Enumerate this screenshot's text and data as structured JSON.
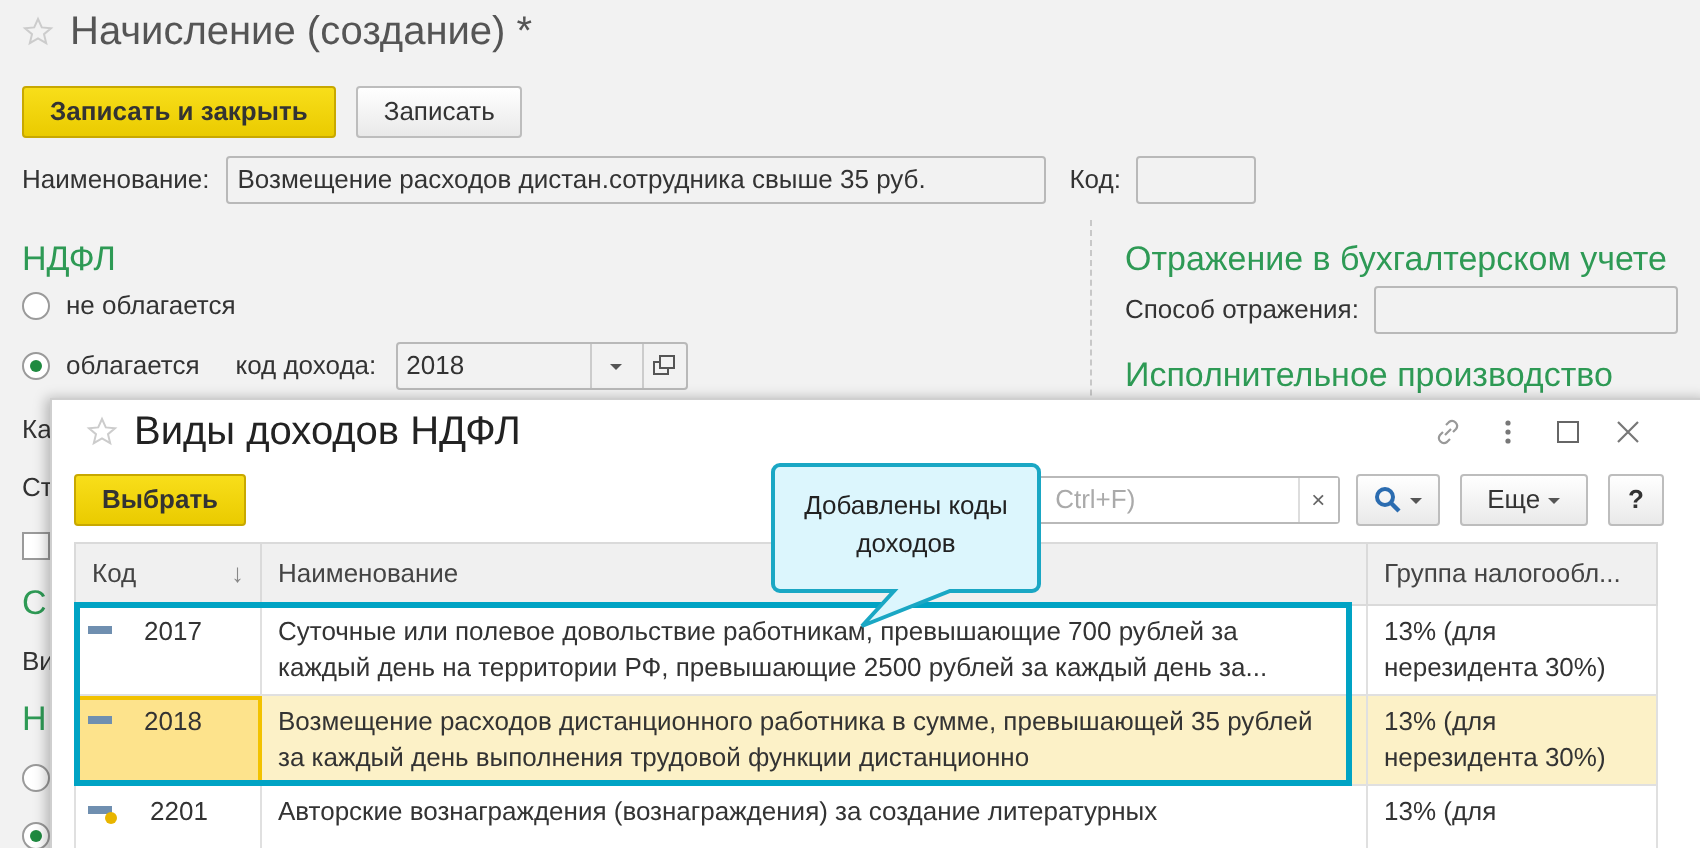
{
  "form": {
    "title": "Начисление (создание) *",
    "favorite": false,
    "buttons": [
      {
        "label": "Записать и закрыть",
        "kind": "primary"
      },
      {
        "label": "Записать",
        "kind": "default"
      }
    ],
    "name_label": "Наименование:",
    "name_value": "Возмещение расходов дистан.сотрудника свыше 35 руб.",
    "code_label": "Код:",
    "ndfl": {
      "heading": "НДФЛ",
      "options": [
        {
          "label": "не облагается",
          "selected": false
        },
        {
          "label": "облагается",
          "selected": true
        }
      ],
      "income_code_label": "код дохода:",
      "income_code_value": "2018"
    },
    "accounting": {
      "heading": "Отражение в бухгалтерском учете",
      "method_label": "Способ отражения:"
    },
    "enforcement_heading": "Исполнительное производство",
    "partial_items": [
      {
        "kind": "label",
        "text": "Ка"
      },
      {
        "kind": "label",
        "text": "Ст"
      },
      {
        "kind": "checkbox",
        "checked": false
      },
      {
        "kind": "heading",
        "text": "С"
      },
      {
        "kind": "label",
        "text": "Ви"
      },
      {
        "kind": "heading",
        "text": "Н"
      },
      {
        "kind": "radio",
        "selected": false
      },
      {
        "kind": "radio",
        "selected": true
      }
    ]
  },
  "dialog": {
    "title": "Виды доходов НДФЛ",
    "favorite": false,
    "toolbar": {
      "choose_button": "Выбрать",
      "search_placeholder": "Ctrl+F)",
      "clear_button": "×",
      "more_button": "Еще",
      "help_button": "?"
    },
    "callout": {
      "text": "Добавлены коды доходов"
    },
    "table": {
      "columns": [
        {
          "label": "Код",
          "sort_mark": "↓"
        },
        {
          "label": "Наименование"
        },
        {
          "label": "Группа налогообл..."
        }
      ],
      "rows": [
        {
          "code": "2017",
          "name": "Суточные или полевое довольствие работникам, превышающие 700 рублей за каждый день на территории РФ, превышающие 2500 рублей за каждый день за...",
          "group": "13% (для нерезидента 30%)",
          "selected": false,
          "highlighted": true,
          "marked": false
        },
        {
          "code": "2018",
          "name": "Возмещение расходов дистанционного работника в сумме, превышающей 35 рублей за каждый день выполнения трудовой функции дистанционно",
          "group": "13% (для нерезидента 30%)",
          "selected": true,
          "highlighted": true,
          "marked": false
        },
        {
          "code": "2201",
          "name": "Авторские вознаграждения (вознаграждения) за создание литературных",
          "group": "13% (для",
          "selected": false,
          "highlighted": false,
          "marked": true
        }
      ]
    }
  }
}
